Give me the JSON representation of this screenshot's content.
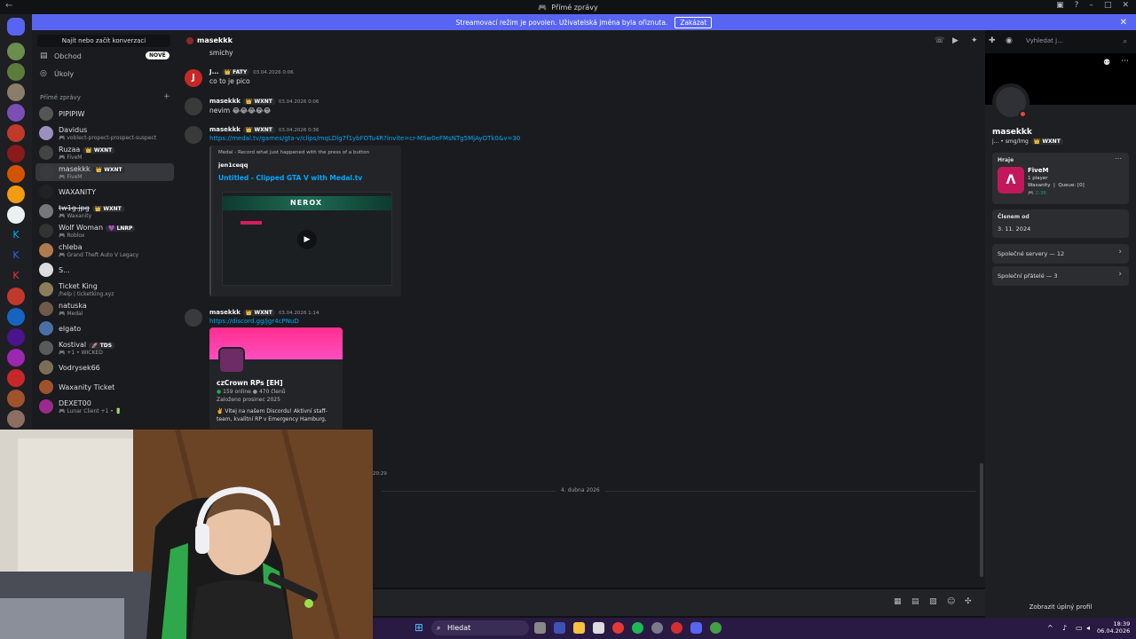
{
  "window": {
    "title": "Přímé zprávy"
  },
  "banner": {
    "text": "Streamovací režim je povolen. Uživatelská jména byla ořiznuta.",
    "button": "Zakázat"
  },
  "sidebar": {
    "search": "Najít nebo začít konverzaci",
    "shop": "Obchod",
    "shop_badge": "NOVÉ",
    "tasks": "Úkoly",
    "dm_header": "Přímé zprávy",
    "dms": [
      {
        "name": "PIPIPIW",
        "sub": ""
      },
      {
        "name": "Davidus",
        "sub": "🎮 voblect-propect-prospect-suspect"
      },
      {
        "name": "Ruzaa",
        "tag": "👑 WXNT",
        "sub": "🎮 FiveM"
      },
      {
        "name": "masekkk",
        "tag": "👑 WXNT",
        "sub": "🎮 FiveM"
      },
      {
        "name": "WAXANITY",
        "sub": ""
      },
      {
        "name": "tw1g.jpg",
        "tag": "👑 WXNT",
        "sub": "🎮 Waxanity"
      },
      {
        "name": "Wolf Woman",
        "tag": "💜 LNRP",
        "sub": "🎮 Roblox"
      },
      {
        "name": "chleba",
        "sub": "🎮 Grand Theft Auto V Legacy"
      },
      {
        "name": "S...",
        "sub": ""
      },
      {
        "name": "Ticket King",
        "sub": "/help | ticketking.xyz"
      },
      {
        "name": "natuska",
        "sub": "🎮 Medal"
      },
      {
        "name": "elgato",
        "sub": ""
      },
      {
        "name": "Kostival",
        "tag": "🚀 TDS",
        "sub": "🎮 +1 • WICKED"
      },
      {
        "name": "Vodrysek66",
        "sub": ""
      },
      {
        "name": "Waxanity Ticket",
        "sub": ""
      },
      {
        "name": "DEXET00",
        "sub": "🎮 Lunar Client +1 • 🔋"
      }
    ]
  },
  "chat": {
    "header_name": "masekkk",
    "search_placeholder": "Vyhledat j...",
    "top_text": "smichy",
    "messages": [
      {
        "name": "J...",
        "tag": "👑 FATY",
        "time": "03.04.2026 0:06",
        "text": "co to je pico"
      },
      {
        "name": "masekkk",
        "tag": "👑 WXNT",
        "time": "03.04.2026 0:06",
        "text": "nevim 😂😂😂😂😂"
      },
      {
        "name": "masekkk",
        "tag": "👑 WXNT",
        "time": "03.04.2026 0:36",
        "text": "https://medal.tv/games/gta-v/clips/mqLDlg7f1ybFOTu4R?invite=cr-MSw0eFMsNTg5MjAyOTk0&v=30"
      },
      {
        "name": "masekkk",
        "tag": "👑 WXNT",
        "time": "03.04.2026 1:14",
        "text": "https://discord.gg/jgr4cPNuD"
      }
    ],
    "embed1": {
      "provider": "Medal - Record what just happened with the press of a button",
      "author": "jen1ceqq",
      "title": "Untitled - Clipped GTA V with Medal.tv",
      "thumb_text": "NEROX"
    },
    "embed2": {
      "name": "czCrown RPs [EH]",
      "online": "159 online",
      "members": "470 členů",
      "founded": "Založeno prosinec 2025",
      "desc": "✌️ Vítej na našem Discordu! Aktivní staff-team, kvalitní RP v Emergency Hamburg,"
    },
    "time_small": "20:29",
    "date_divider": "4. dubna 2026"
  },
  "profile": {
    "name": "masekkk",
    "sub": "j... • smg/lmg",
    "tag": "👑 WXNT",
    "playing_header": "Hraje",
    "game": "FiveM",
    "game_players": "1 player",
    "game_detail": "Waxanity  |  Queue: [0]",
    "game_time": "🎮 2:36",
    "member_since_header": "Členem od",
    "member_since": "3. 11. 2024",
    "mutual_servers": "Společné servery — 12",
    "mutual_friends": "Společní přátelé — 3",
    "view_full": "Zobrazit úplný profil"
  },
  "taskbar": {
    "search": "Hledat",
    "time": "18:39",
    "date": "06.04.2026"
  },
  "colors": {
    "accent": "#5865f2",
    "link": "#00a8fc",
    "taskbar": "#281a42"
  }
}
